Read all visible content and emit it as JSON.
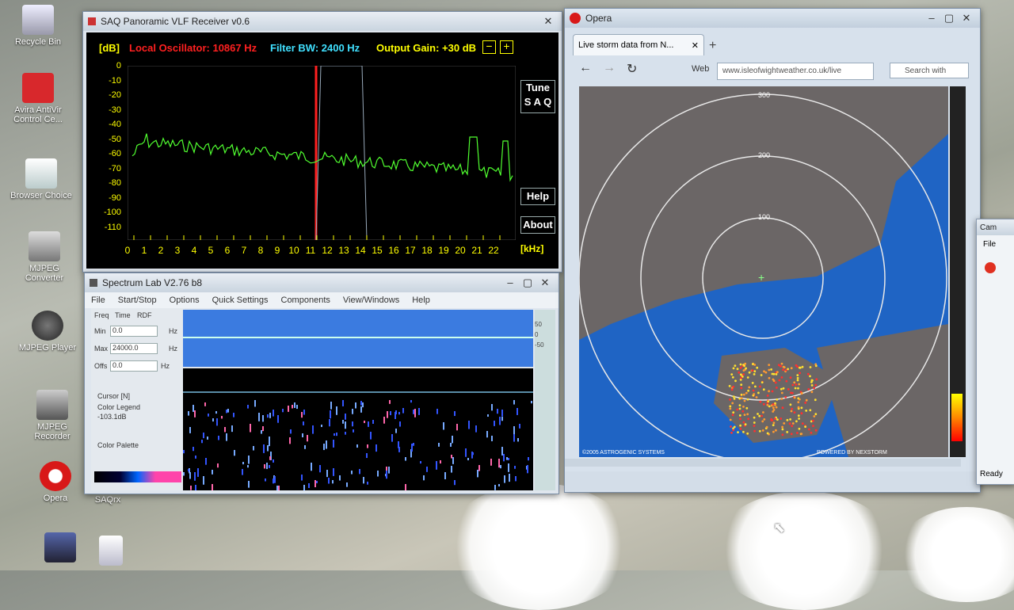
{
  "desktop": {
    "icons": [
      {
        "label": "Recycle Bin"
      },
      {
        "label": "Avira AntiVir Control Ce..."
      },
      {
        "label": "Browser Choice"
      },
      {
        "label": "MJPEG Converter"
      },
      {
        "label": "MJPEG Player"
      },
      {
        "label": "MJPEG Recorder"
      },
      {
        "label": "Opera"
      },
      {
        "label": "SAQrx"
      }
    ]
  },
  "saq": {
    "title": "SAQ Panoramic VLF Receiver v0.6",
    "db_label": "[dB]",
    "local_osc": "Local Oscillator: 10867 Hz",
    "filter_bw": "Filter BW: 2400 Hz",
    "output_gain": "Output Gain: +30 dB",
    "minus": "−",
    "plus": "+",
    "tune_label": "Tune",
    "saq_label": "S A Q",
    "help_label": "Help",
    "about_label": "About",
    "khz_label": "[kHz]",
    "y_ticks": [
      "0",
      "-10",
      "-20",
      "-30",
      "-40",
      "-50",
      "-60",
      "-70",
      "-80",
      "-90",
      "-100",
      "-110"
    ],
    "x_ticks": [
      "0",
      "1",
      "2",
      "3",
      "4",
      "5",
      "6",
      "7",
      "8",
      "9",
      "10",
      "11",
      "12",
      "13",
      "14",
      "15",
      "16",
      "17",
      "18",
      "19",
      "20",
      "21",
      "22"
    ],
    "colors": {
      "label": "#ffff00",
      "osc": "#ff2020",
      "filter": "#40e0ff",
      "trace": "#50ff30"
    }
  },
  "spec": {
    "title": "Spectrum Lab V2.76 b8",
    "menu": [
      "File",
      "Start/Stop",
      "Options",
      "Quick Settings",
      "Components",
      "View/Windows",
      "Help"
    ],
    "side_tabs": [
      "Freq",
      "Time",
      "RDF"
    ],
    "min_label": "Min",
    "min_val": "0.0",
    "max_label": "Max",
    "max_val": "24000.0",
    "offs_label": "Offs",
    "offs_val": "0.0",
    "hz": "Hz",
    "cursor": "Cursor [N]",
    "color_legend": "Color Legend",
    "legend_val": "-103.1dB",
    "color_palette": "Color Palette",
    "scale": [
      "50",
      "0",
      "-50"
    ]
  },
  "opera": {
    "title": "Opera",
    "tab_label": "Live storm data from N...",
    "web_label": "Web",
    "address": "www.isleofwightweather.co.uk/live",
    "search_placeholder": "Search with",
    "rings": [
      "100",
      "200",
      "300"
    ],
    "copyright": "©2005 ASTROGENIC SYSTEMS",
    "powered": "POWERED BY NEXSTORM"
  },
  "cam": {
    "title": "Cam",
    "menu": "File",
    "status": "Ready"
  }
}
